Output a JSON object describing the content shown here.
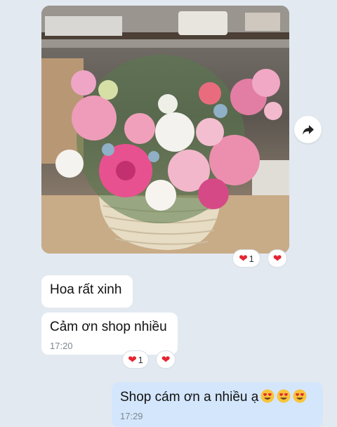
{
  "attachment": {
    "icon": "flower-basket-photo",
    "forward_icon": "forward-arrow-icon",
    "reactions": {
      "count": "1",
      "heart_icon": "heart-icon"
    }
  },
  "messages": [
    {
      "sender": "other",
      "text": "Hoa rất xinh"
    },
    {
      "sender": "other",
      "text": "Cảm ơn shop nhiều",
      "time": "17:20",
      "reactions": {
        "count": "1",
        "heart_icon": "heart-icon"
      }
    },
    {
      "sender": "me",
      "text": "Shop cám ơn a nhiều ạ",
      "time": "17:29",
      "emoji": "heart-eyes-face-icon",
      "emoji_count": 3
    }
  ],
  "colors": {
    "background": "#e2e9f1",
    "other_bubble": "#ffffff",
    "my_bubble": "#d4e6fb",
    "heart": "#e52431",
    "timestamp": "#7e8791"
  }
}
